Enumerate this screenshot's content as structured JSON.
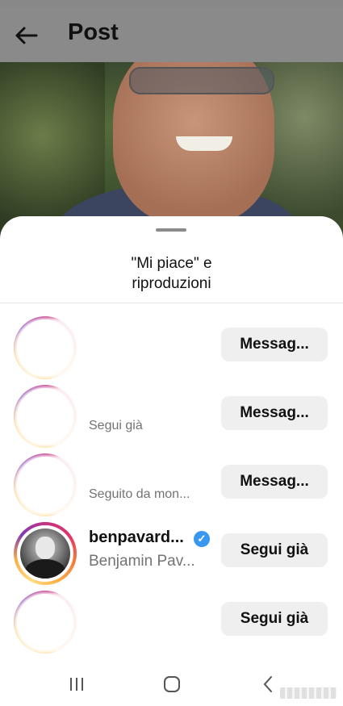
{
  "header": {
    "title": "Post"
  },
  "sheet": {
    "title_line1": "\"Mi piace\" e",
    "title_line2": "riproduzioni"
  },
  "rows": [
    {
      "username": "",
      "subtext": "",
      "button": "Messag..."
    },
    {
      "username": "",
      "subtext": "Segui già",
      "button": "Messag..."
    },
    {
      "username": "",
      "subtext": "Seguito da mon...",
      "button": "Messag..."
    },
    {
      "username": "benpavard...",
      "subtext": "Benjamin Pav...",
      "button": "Segui già",
      "verified_icon": "verified-badge-icon"
    },
    {
      "username": "",
      "subtext": "",
      "button": "Segui già"
    }
  ],
  "colors": {
    "accent_verified": "#3897f0",
    "button_bg": "#efefef"
  },
  "icons": {
    "back": "arrow-left-icon",
    "nav_recents": "recents-icon",
    "nav_home": "home-icon",
    "nav_back": "back-chevron-icon"
  }
}
